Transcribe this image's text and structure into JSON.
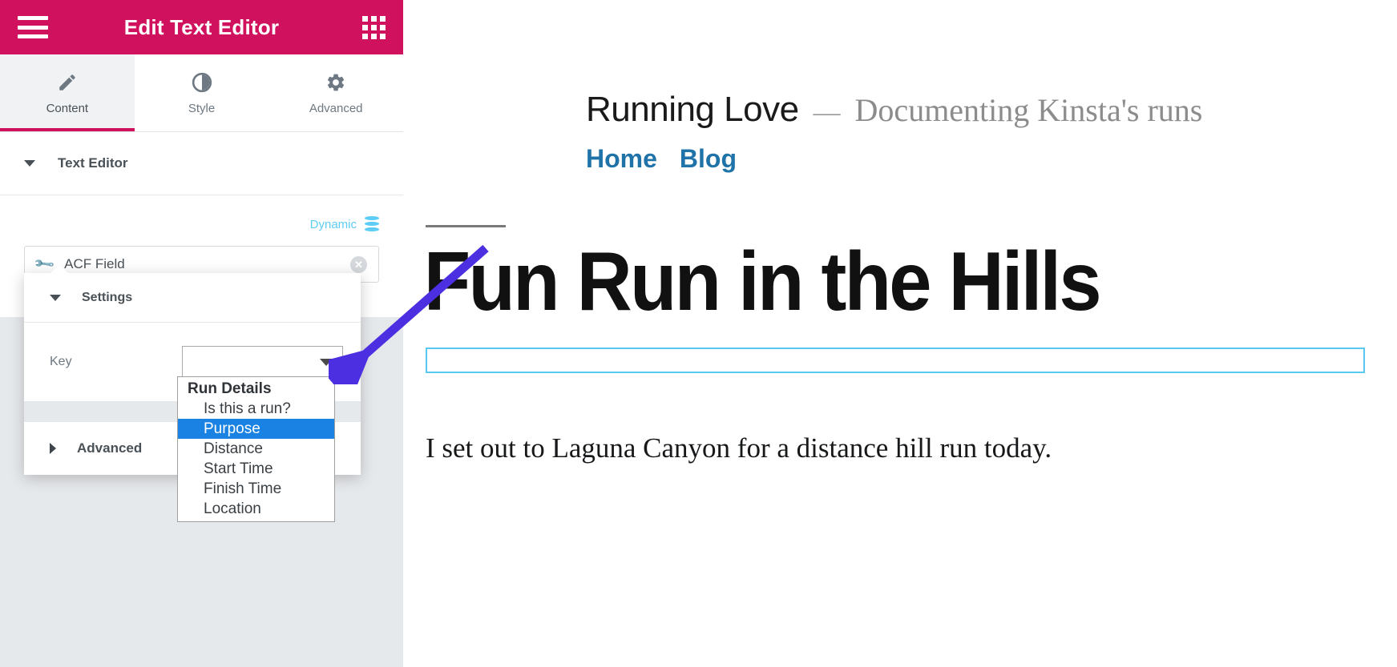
{
  "panel": {
    "header": {
      "menu_icon": "hamburger-icon",
      "title": "Edit Text Editor",
      "apps_icon": "grid-apps-icon",
      "accent_color": "#d0115e"
    },
    "tabs": [
      {
        "label": "Content",
        "icon": "pencil-icon",
        "active": true
      },
      {
        "label": "Style",
        "icon": "contrast-circle-icon",
        "active": false
      },
      {
        "label": "Advanced",
        "icon": "gear-icon",
        "active": false
      }
    ],
    "section": {
      "title": "Text Editor",
      "collapsed": false
    },
    "dynamic": {
      "label": "Dynamic",
      "icon": "database-stack-icon",
      "color": "#5ecdf5"
    },
    "acf_field": {
      "value": "ACF Field",
      "icon": "wrench-icon",
      "clear_icon": "clear-circle-icon"
    },
    "popover": {
      "settings_title": "Settings",
      "key_label": "Key",
      "key_value": "",
      "advanced_title": "Advanced",
      "dropdown_caret": "chevron-down-icon"
    },
    "dropdown": {
      "group_label": "Run Details",
      "selected": "Purpose",
      "highlight_color": "#1a82e2",
      "options": [
        "Is this a run?",
        "Purpose",
        "Distance",
        "Start Time",
        "Finish Time",
        "Location"
      ]
    }
  },
  "preview": {
    "site_title": "Running Love",
    "site_dash": "—",
    "site_tagline": "Documenting Kinsta's runs",
    "nav": [
      {
        "label": "Home"
      },
      {
        "label": "Blog"
      }
    ],
    "nav_color": "#1f73a8",
    "post_title": "Fun Run in the Hills",
    "post_body": "I set out to Laguna Canyon for a distance hill run today.",
    "widget_outline_color": "#5bc8f0",
    "collapse_icon": "chevron-left-icon"
  },
  "annotation": {
    "arrow_color": "#4b2fe0",
    "arrow_name": "pointer-arrow"
  }
}
